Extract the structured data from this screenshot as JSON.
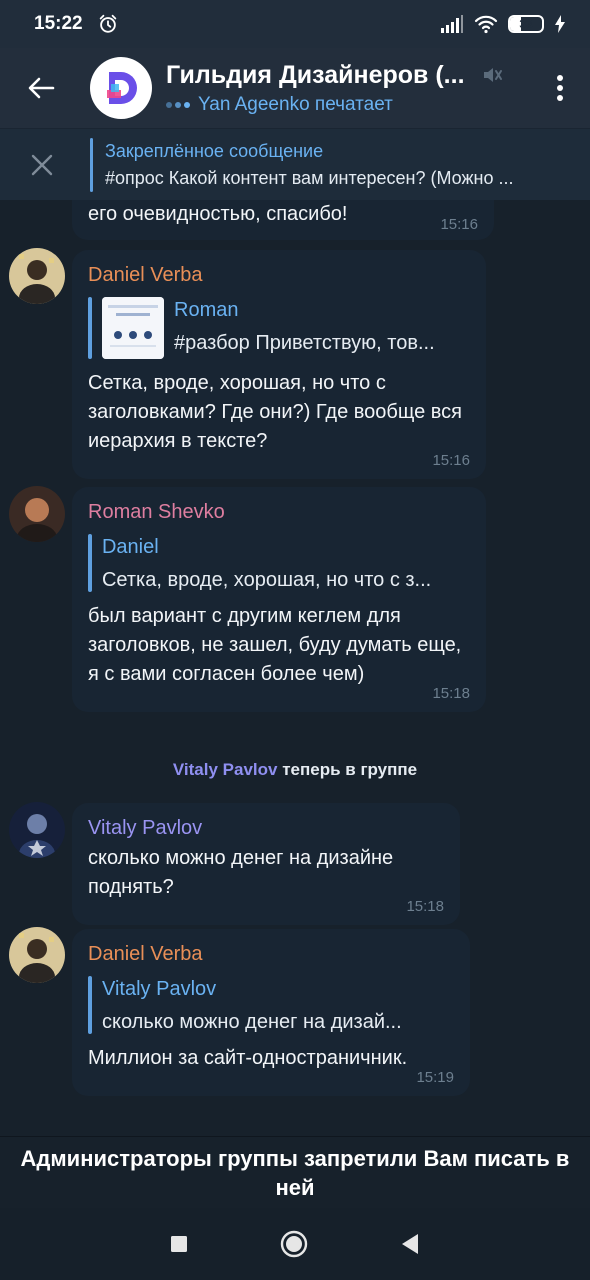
{
  "status": {
    "time": "15:22",
    "battery": "33",
    "battery_percent": 33
  },
  "header": {
    "title": "Гильдия Дизайнеров (...",
    "typing": "Yan Ageenko печатает"
  },
  "pinned": {
    "label": "Закреплённое сообщение",
    "text": "#опрос Какой контент вам интересен? (Можно ..."
  },
  "messages": [
    {
      "text": "его очевидностью, спасибо!",
      "time": "15:16"
    },
    {
      "sender": "Daniel Verba",
      "sender_color": "#e98f57",
      "reply_name": "Roman",
      "reply_text": "#разбор Приветствую, тов...",
      "text": "Сетка, вроде, хорошая, но что с заголовками? Где они?) Где вообще вся иерархия в тексте?",
      "time": "15:16"
    },
    {
      "sender": "Roman Shevko",
      "sender_color": "#de7ea0",
      "reply_name": "Daniel",
      "reply_text": "Сетка, вроде, хорошая, но что с з...",
      "text": "был вариант с другим кеглем для заголовков, не зашел, буду думать еще, я с вами согласен более чем)",
      "time": "15:18"
    },
    {
      "sender": "Vitaly Pavlov",
      "sender_color": "#9a94f2",
      "text": "сколько можно денег на дизайне поднять?",
      "time": "15:18"
    },
    {
      "sender": "Daniel Verba",
      "sender_color": "#e98f57",
      "reply_name": "Vitaly Pavlov",
      "reply_text": "сколько можно денег на дизай...",
      "text": "Миллион за сайт-одностраничник.",
      "time": "15:19"
    }
  ],
  "service": {
    "name": "Vitaly Pavlov",
    "action": "теперь в группе"
  },
  "restriction": "Администраторы группы запретили Вам писать в ней",
  "colors": {
    "background": "#17212b",
    "bubble": "#182533",
    "accent": "#6ab2f2",
    "header": "#232e3c"
  },
  "icons": [
    "back-arrow-icon",
    "mute-icon",
    "more-vert-icon",
    "close-icon",
    "alarm-icon",
    "signal-icon",
    "wifi-icon",
    "battery-icon",
    "charging-icon",
    "nav-square-icon",
    "nav-circle-icon",
    "nav-back-icon"
  ]
}
